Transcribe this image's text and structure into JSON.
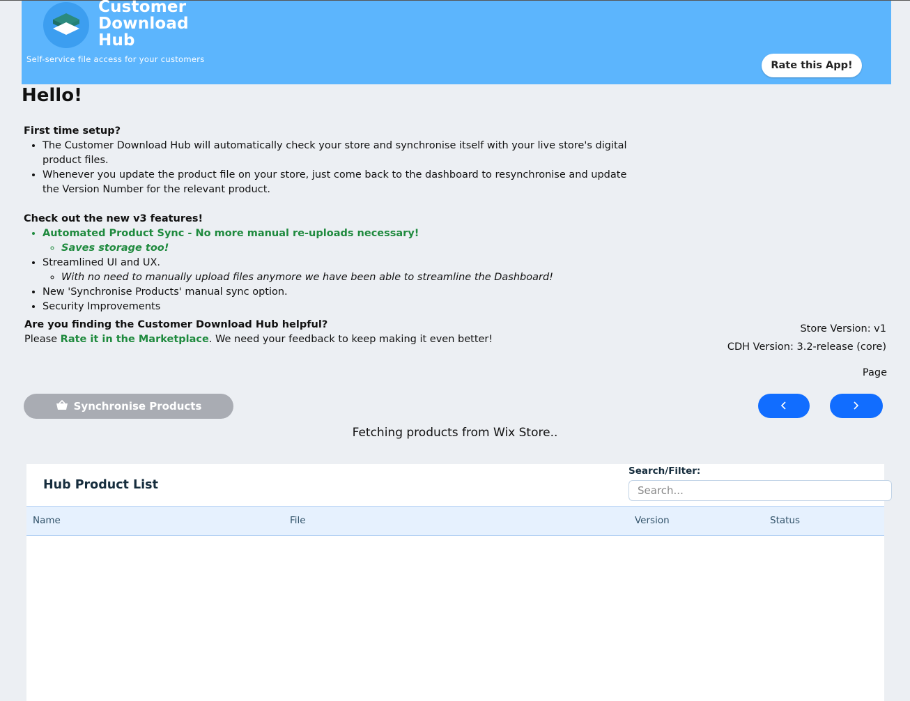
{
  "app": {
    "brand_line1": "Customer",
    "brand_line2": "Download",
    "brand_line3": "Hub",
    "tagline": "Self-service file access for your customers",
    "rate_button": "Rate this App!",
    "accent": "#116dff",
    "banner_color": "#5cb5fd"
  },
  "greeting": "Hello!",
  "setup": {
    "heading": "First time setup?",
    "items": [
      "The Customer Download Hub will  automatically check your store and synchronise itself with your live store's digital product files.",
      "Whenever you update the product file on your store, just come back to the dashboard to resynchronise and update the Version Number for the relevant product."
    ]
  },
  "features": {
    "heading": "Check out the new v3 features!",
    "item1": "Automated Product Sync - No more manual re-uploads necessary!",
    "item1_sub": "Saves storage too!",
    "item2": "Streamlined UI and UX.",
    "item2_sub": "With no need to manually upload files anymore we have been able to streamline the Dashboard!",
    "item3": "New 'Synchronise Products' manual sync option.",
    "item4": "Security Improvements"
  },
  "feedback": {
    "question": "Are you finding the Customer Download Hub helpful?",
    "prefix": "Please ",
    "link": "Rate it in the Marketplace",
    "suffix": ". We need your feedback to keep making it even better!"
  },
  "versions": {
    "store": "Store Version: v1",
    "cdh": "CDH Version: 3.2-release (core)"
  },
  "pagination": {
    "label": "Page",
    "prev_icon": "chevron-left-icon",
    "next_icon": "chevron-right-icon"
  },
  "sync_button": {
    "label": "Synchronise Products",
    "icon": "shopping-bag-icon"
  },
  "status_message": "Fetching products from Wix Store..",
  "table": {
    "title": "Hub Product List",
    "filter_label": "Search/Filter:",
    "search_placeholder": "Search...",
    "search_value": "",
    "columns": [
      "Name",
      "File",
      "Version",
      "Status"
    ],
    "rows": []
  }
}
